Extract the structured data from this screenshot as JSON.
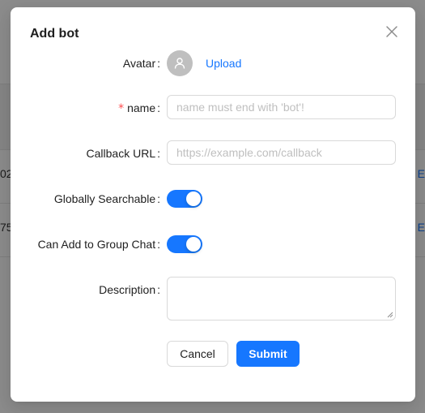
{
  "background": {
    "row1_left": "02",
    "row1_right": "E",
    "row2_left": "75",
    "row2_right": "E"
  },
  "modal": {
    "title": "Add bot",
    "avatar": {
      "label": "Avatar",
      "upload_label": "Upload",
      "icon": "user-icon"
    },
    "name": {
      "label": "name",
      "required_mark": "*",
      "placeholder": "name must end with 'bot'!",
      "value": ""
    },
    "callback": {
      "label": "Callback URL",
      "placeholder": "https://example.com/callback",
      "value": ""
    },
    "globally_searchable": {
      "label": "Globally Searchable",
      "checked": true
    },
    "group_chat": {
      "label": "Can Add to Group Chat",
      "checked": true
    },
    "description": {
      "label": "Description",
      "value": ""
    },
    "colon": ":",
    "cancel_label": "Cancel",
    "submit_label": "Submit"
  },
  "colors": {
    "primary": "#1677ff",
    "required": "#ff4d4f",
    "overlay": "rgba(0,0,0,0.45)"
  }
}
